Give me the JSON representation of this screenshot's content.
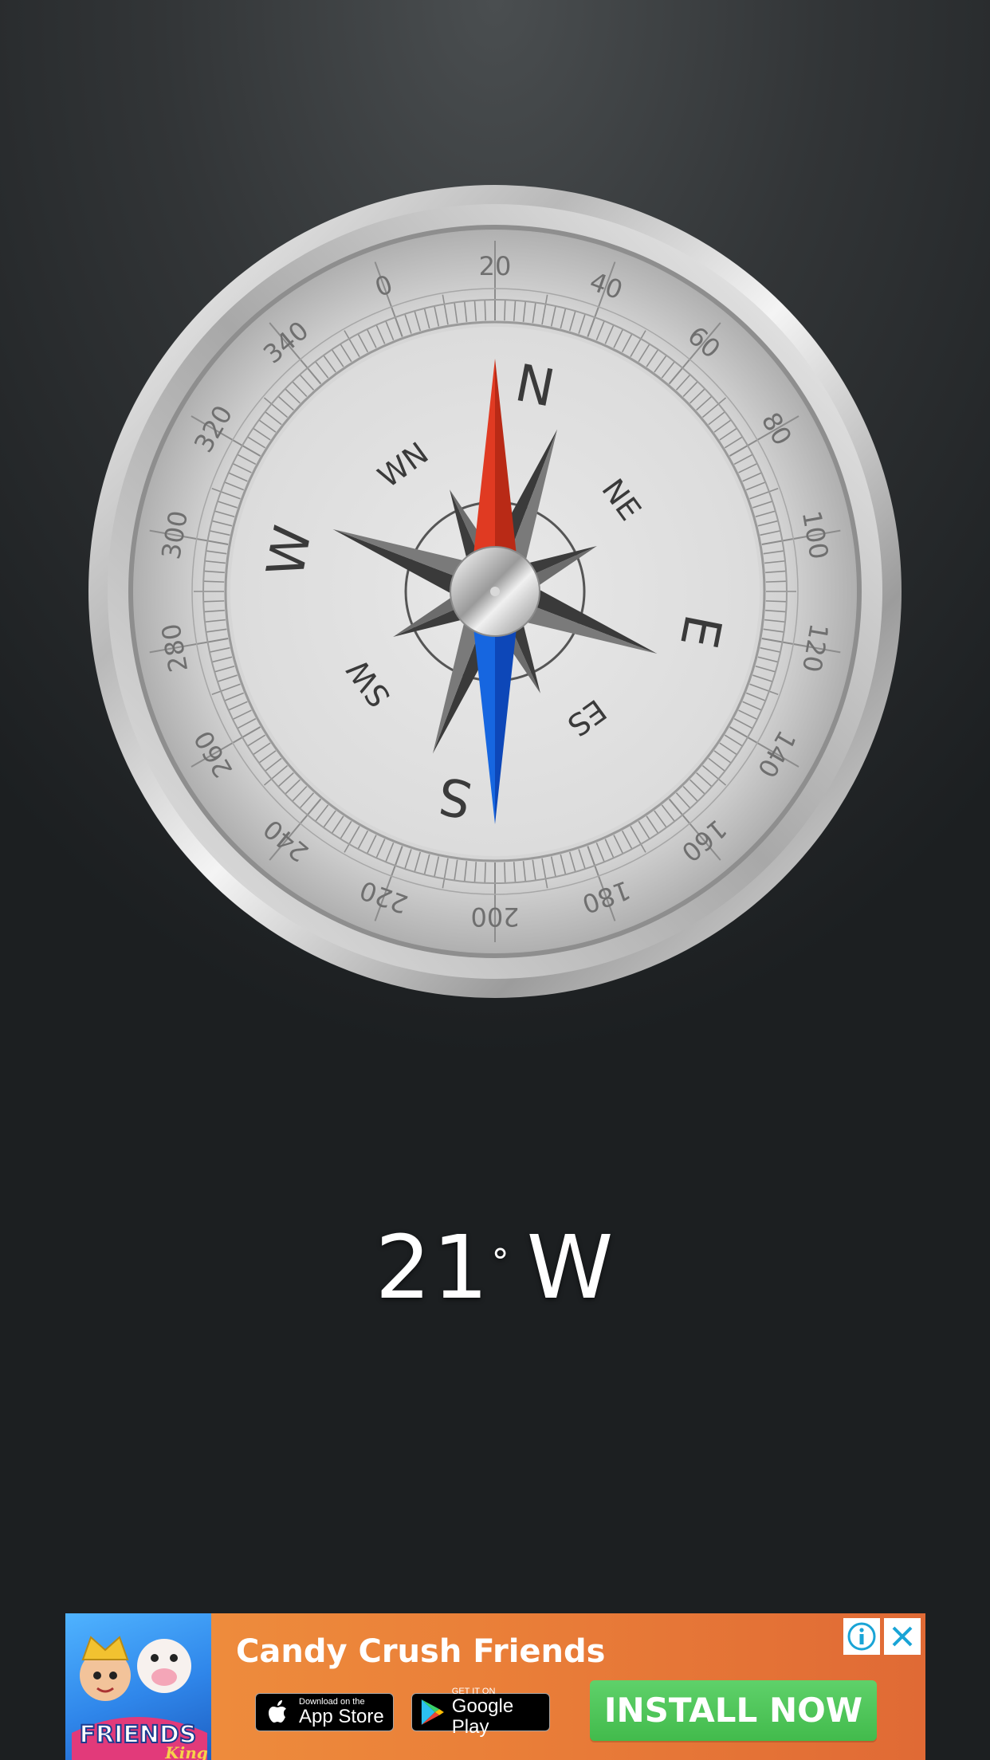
{
  "compass": {
    "degree_labels": [
      "0",
      "20",
      "40",
      "60",
      "80",
      "100",
      "120",
      "140",
      "160",
      "180",
      "200",
      "220",
      "240",
      "260",
      "280",
      "300",
      "320",
      "340"
    ],
    "cardinal_labels": [
      "N",
      "E",
      "S",
      "W"
    ],
    "intercardinal_labels": [
      "NE",
      "ES",
      "SW",
      "WN"
    ],
    "north_color": "#e03a22",
    "south_color": "#1666e0"
  },
  "heading": {
    "value": "21",
    "degree_symbol": "°",
    "direction": "W"
  },
  "ad": {
    "title": "Candy Crush Friends",
    "art_label": "FRIENDS",
    "art_brand": "King",
    "appstore_small": "Download on the",
    "appstore_big": "App Store",
    "googleplay_small": "GET IT ON",
    "googleplay_big": "Google Play",
    "install_label": "INSTALL NOW"
  }
}
